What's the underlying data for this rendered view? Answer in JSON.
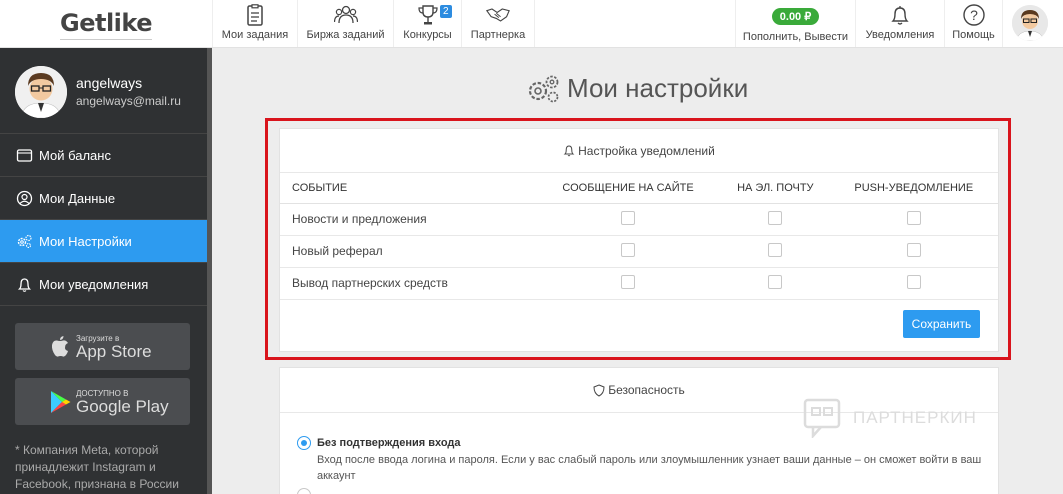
{
  "logo": "Getlike",
  "nav": {
    "tasks": "Мои задания",
    "exchange": "Биржа заданий",
    "contests": "Конкурсы",
    "contests_badge": "2",
    "partner": "Партнерка",
    "balance_value": "0.00 ₽",
    "balance_label": "Пополнить, Вывести",
    "notifications": "Уведомления",
    "help": "Помощь"
  },
  "profile": {
    "name": "angelways",
    "email": "angelways@mail.ru"
  },
  "sidebar": {
    "items": [
      {
        "label": "Мой баланс"
      },
      {
        "label": "Мои Данные"
      },
      {
        "label": "Мои Настройки"
      },
      {
        "label": "Мои уведомления"
      }
    ],
    "appstore_small": "Загрузите в",
    "appstore_big": "App Store",
    "googleplay_small": "ДОСТУПНО В",
    "googleplay_big": "Google Play",
    "footnote": "* Компания Meta, которой принадлежит Instagram и Facebook, признана в России"
  },
  "page_title": "Мои настройки",
  "notifications_card": {
    "title": "Настройка уведомлений",
    "columns": [
      "Событие",
      "Сообщение на сайте",
      "На эл. почту",
      "Push-уведомление"
    ],
    "rows": [
      {
        "label": "Новости и предложения"
      },
      {
        "label": "Новый реферал"
      },
      {
        "label": "Вывод партнерских средств"
      }
    ],
    "save_label": "Сохранить"
  },
  "security_card": {
    "title": "Безопасность",
    "option1_title": "Без подтверждения входа",
    "option1_desc": "Вход после ввода логина и пароля. Если у вас слабый пароль или злоумышленник узнает ваши данные – он сможет войти в ваш аккаунт"
  },
  "watermark": "ПАРТНЕРКИН",
  "colors": {
    "accent": "#2d9bf0",
    "sidebar_bg": "#2f3133",
    "highlight": "#d9141c",
    "balance_green": "#3aaa3a"
  }
}
